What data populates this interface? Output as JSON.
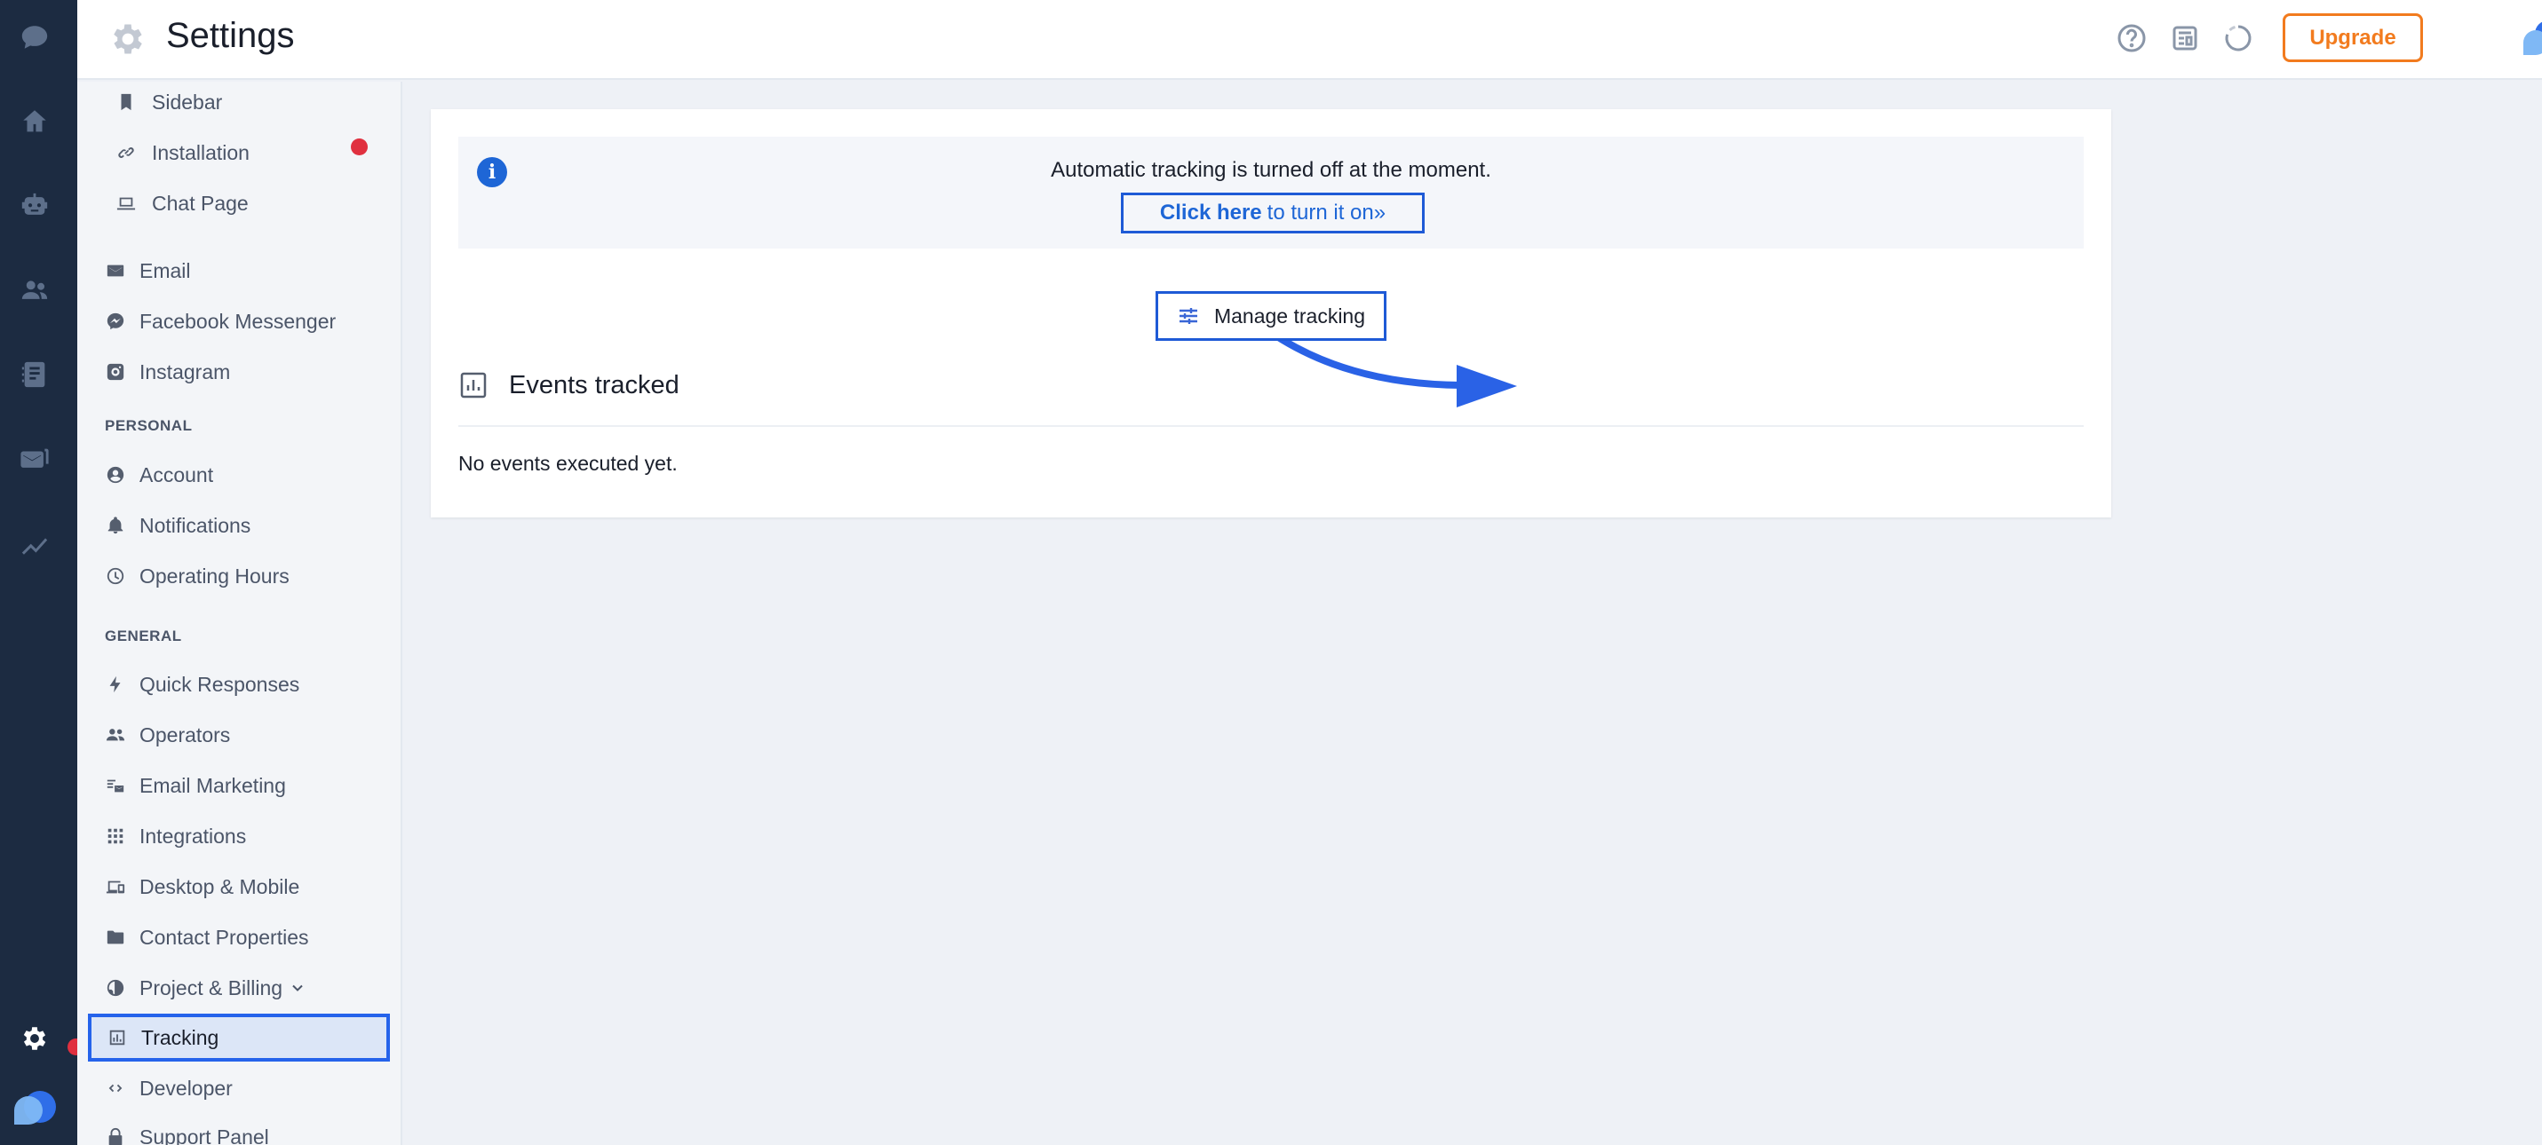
{
  "header": {
    "title": "Settings",
    "upgrade_label": "Upgrade"
  },
  "sidebar": {
    "items": [
      {
        "label": "Sidebar",
        "icon": "bookmark-icon"
      },
      {
        "label": "Installation",
        "icon": "link-icon",
        "badge": "alert-dot"
      },
      {
        "label": "Chat Page",
        "icon": "laptop-icon"
      },
      {
        "label": "Email",
        "icon": "mail-icon"
      },
      {
        "label": "Facebook Messenger",
        "icon": "messenger-icon"
      },
      {
        "label": "Instagram",
        "icon": "instagram-icon"
      },
      {
        "label": "Account",
        "icon": "account-icon"
      },
      {
        "label": "Notifications",
        "icon": "bell-icon"
      },
      {
        "label": "Operating Hours",
        "icon": "clock-icon"
      },
      {
        "label": "Quick Responses",
        "icon": "bolt-icon"
      },
      {
        "label": "Operators",
        "icon": "people-icon"
      },
      {
        "label": "Email Marketing",
        "icon": "email-marketing-icon"
      },
      {
        "label": "Integrations",
        "icon": "grid-icon"
      },
      {
        "label": "Desktop & Mobile",
        "icon": "devices-icon"
      },
      {
        "label": "Contact Properties",
        "icon": "folder-icon"
      },
      {
        "label": "Project & Billing",
        "icon": "globe-icon"
      },
      {
        "label": "Tracking",
        "icon": "chart-icon",
        "selected": true
      },
      {
        "label": "Developer",
        "icon": "code-icon"
      },
      {
        "label": "Support Panel",
        "icon": "lock-icon"
      }
    ],
    "sections": {
      "personal": "PERSONAL",
      "general": "GENERAL"
    }
  },
  "main": {
    "banner_message": "Automatic tracking is turned off at the moment.",
    "turn_on_bold": "Click here",
    "turn_on_rest": "to turn it on»",
    "manage_label": "Manage tracking",
    "events_title": "Events tracked",
    "empty_message": "No events executed yet."
  },
  "colors": {
    "rail_bg": "#1c2b41",
    "accent_blue": "#2563eb",
    "upgrade_orange": "#f27b1e",
    "alert_red": "#e0303f",
    "online_green": "#22c55e"
  }
}
